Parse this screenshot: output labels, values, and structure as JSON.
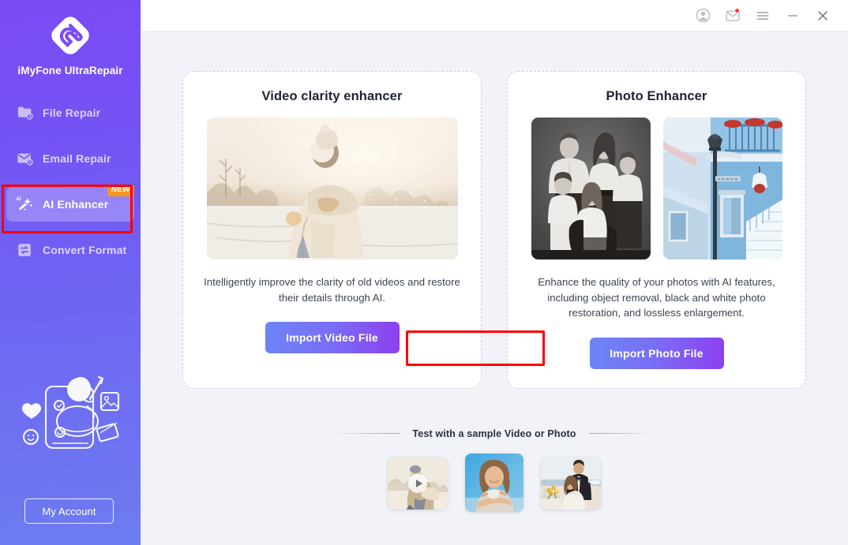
{
  "app": {
    "brand_name": "iMyFone UltraRepair"
  },
  "titlebar": {
    "buttons": [
      {
        "name": "account-icon",
        "label": "Account"
      },
      {
        "name": "mail-icon",
        "label": "Messages"
      },
      {
        "name": "menu-icon",
        "label": "Menu"
      },
      {
        "name": "minimize-icon",
        "label": "Minimize"
      },
      {
        "name": "close-icon",
        "label": "Close"
      }
    ]
  },
  "sidebar": {
    "items": [
      {
        "label": "File Repair",
        "icon": "folder-clock-icon",
        "active": false,
        "badge": ""
      },
      {
        "label": "Email Repair",
        "icon": "envelope-clock-icon",
        "active": false,
        "badge": ""
      },
      {
        "label": "AI Enhancer",
        "icon": "magic-wand-icon",
        "active": true,
        "badge": "NEW"
      },
      {
        "label": "Convert Format",
        "icon": "file-swap-icon",
        "active": false,
        "badge": ""
      }
    ],
    "account_button": "My Account"
  },
  "main": {
    "cards": [
      {
        "title": "Video clarity enhancer",
        "description": "Intelligently improve the clarity of old videos and restore their details through AI.",
        "button": "Import Video File"
      },
      {
        "title": "Photo Enhancer",
        "description": "Enhance the quality of your photos with AI features, including object removal, black and white photo restoration, and lossless enlargement.",
        "button": "Import Photo File"
      }
    ],
    "sample_section_label": "Test with a sample Video or Photo",
    "samples": [
      {
        "name": "sample-video-winter-couple",
        "type": "video"
      },
      {
        "name": "sample-photo-woman-portrait",
        "type": "photo"
      },
      {
        "name": "sample-photo-wedding-couple",
        "type": "photo"
      }
    ]
  },
  "annotations": {
    "highlight_sidebar_item": "AI Enhancer",
    "highlight_button": "Import Video File",
    "highlight_color": "#fd0000"
  },
  "colors": {
    "sidebar_gradient_start": "#7b4af5",
    "sidebar_gradient_end": "#6d7cf0",
    "accent_button_start": "#6b85f6",
    "accent_button_end": "#8d3ff0",
    "badge_new": "#f79420",
    "main_background": "#f1f3f8",
    "card_background": "#ffffff",
    "card_border": "#c9ccd8"
  }
}
